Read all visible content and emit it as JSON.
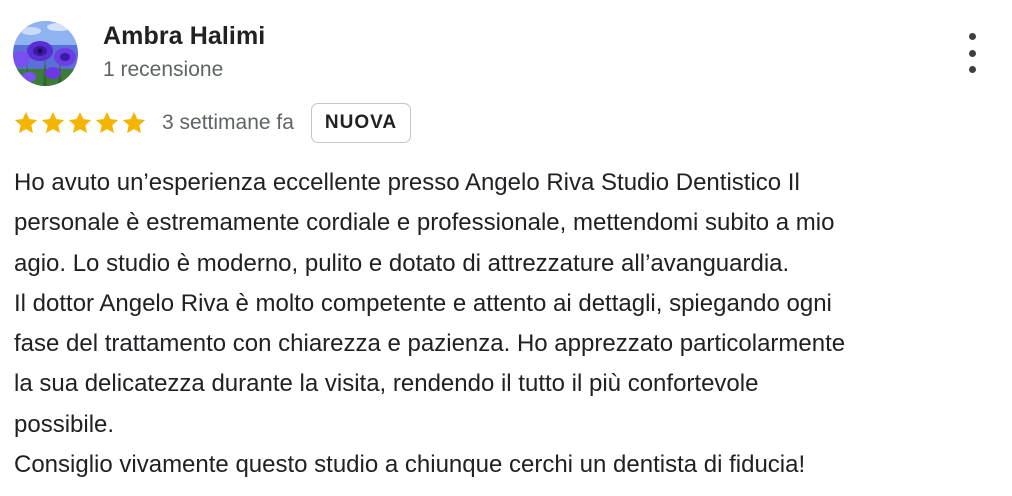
{
  "reviewer": {
    "name": "Ambra Halimi",
    "review_count": "1 recensione",
    "avatar_icon": "flower-photo-avatar"
  },
  "menu": {
    "icon": "more-vert-icon"
  },
  "rating": {
    "stars": 5,
    "max_stars": 5,
    "star_color": "#f4b400",
    "time_ago": "3 settimane fa",
    "badge": "NUOVA"
  },
  "review": {
    "lines": [
      "Ho avuto un’esperienza eccellente presso Angelo Riva Studio Dentistico Il",
      "personale è estremamente cordiale e professionale, mettendomi subito a mio",
      "agio. Lo studio è moderno, pulito e dotato di attrezzature all’avanguardia.",
      "Il dottor Angelo Riva è molto competente e attento ai dettagli, spiegando ogni",
      "fase del trattamento con chiarezza e pazienza. Ho apprezzato particolarmente",
      "la sua delicatezza durante la visita, rendendo il tutto il più confortevole",
      "possibile.",
      "Consiglio vivamente questo studio a chiunque cerchi un dentista di fiducia!"
    ]
  }
}
